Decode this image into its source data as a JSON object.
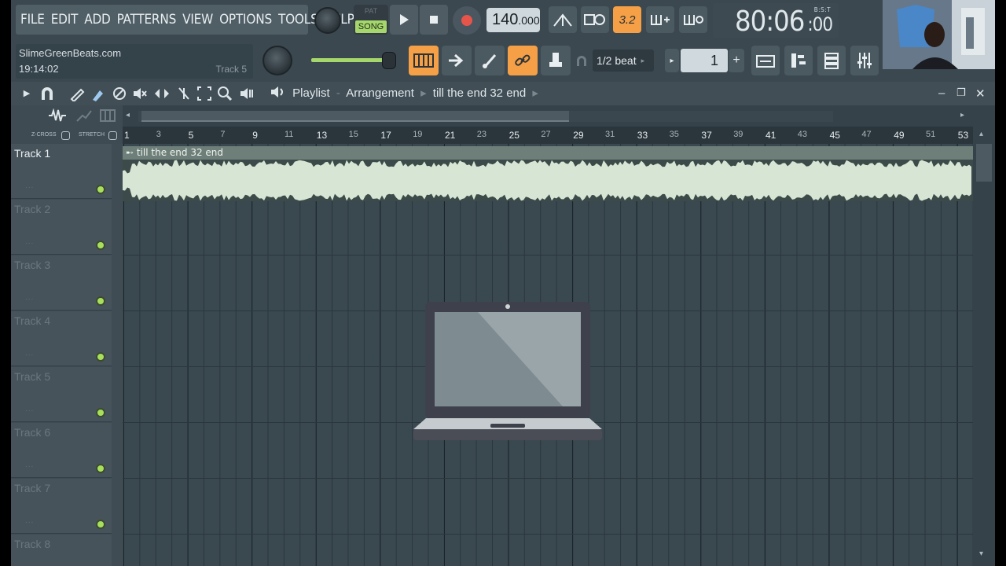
{
  "menu": [
    "FILE",
    "EDIT",
    "ADD",
    "PATTERNS",
    "VIEW",
    "OPTIONS",
    "TOOLS",
    "HELP"
  ],
  "hint": {
    "title": "SlimeGreenBeats.com",
    "time": "19:14:02",
    "track": "Track 5"
  },
  "transport": {
    "pat_label": "PAT",
    "song_label": "SONG",
    "tempo_main": "140",
    "tempo_decimal": ".000",
    "time_signature_btn": "3.2",
    "clock_main": "80:06",
    "clock_small": ":00",
    "clock_mode": "B:S:T"
  },
  "snap": {
    "value": "1/2 beat"
  },
  "pattern": {
    "number": "1"
  },
  "playlist": {
    "title": "Playlist",
    "view": "Arrangement",
    "arrangement_name": "till the end 32 end"
  },
  "options": {
    "zcross": "Z-CROSS",
    "stretch": "STRETCH"
  },
  "ruler": [
    "1",
    "3",
    "5",
    "7",
    "9",
    "11",
    "13",
    "15",
    "17",
    "19",
    "21",
    "23",
    "25",
    "27",
    "29",
    "31",
    "33",
    "35",
    "37",
    "39",
    "41",
    "43",
    "45",
    "47",
    "49",
    "51",
    "53"
  ],
  "tracks": [
    "Track 1",
    "Track 2",
    "Track 3",
    "Track 4",
    "Track 5",
    "Track 6",
    "Track 7",
    "Track 8"
  ],
  "clip": {
    "label": "till the end 32 end",
    "color": "#d7e6d4"
  },
  "colors": {
    "accent_orange": "#f5a046",
    "led_green": "#a9e05b",
    "background": "#3a464d"
  },
  "icons": [
    "knob-icon",
    "play-icon",
    "stop-icon",
    "record-icon",
    "metronome-icon",
    "step-edit-icon",
    "typing-keyboard-icon",
    "link-icon",
    "magnet-icon",
    "pencil-icon",
    "paint-icon",
    "delete-icon",
    "mute-icon",
    "slip-icon",
    "slice-icon",
    "select-icon",
    "zoom-icon",
    "playback-icon",
    "speaker-icon",
    "laptop-icon"
  ]
}
